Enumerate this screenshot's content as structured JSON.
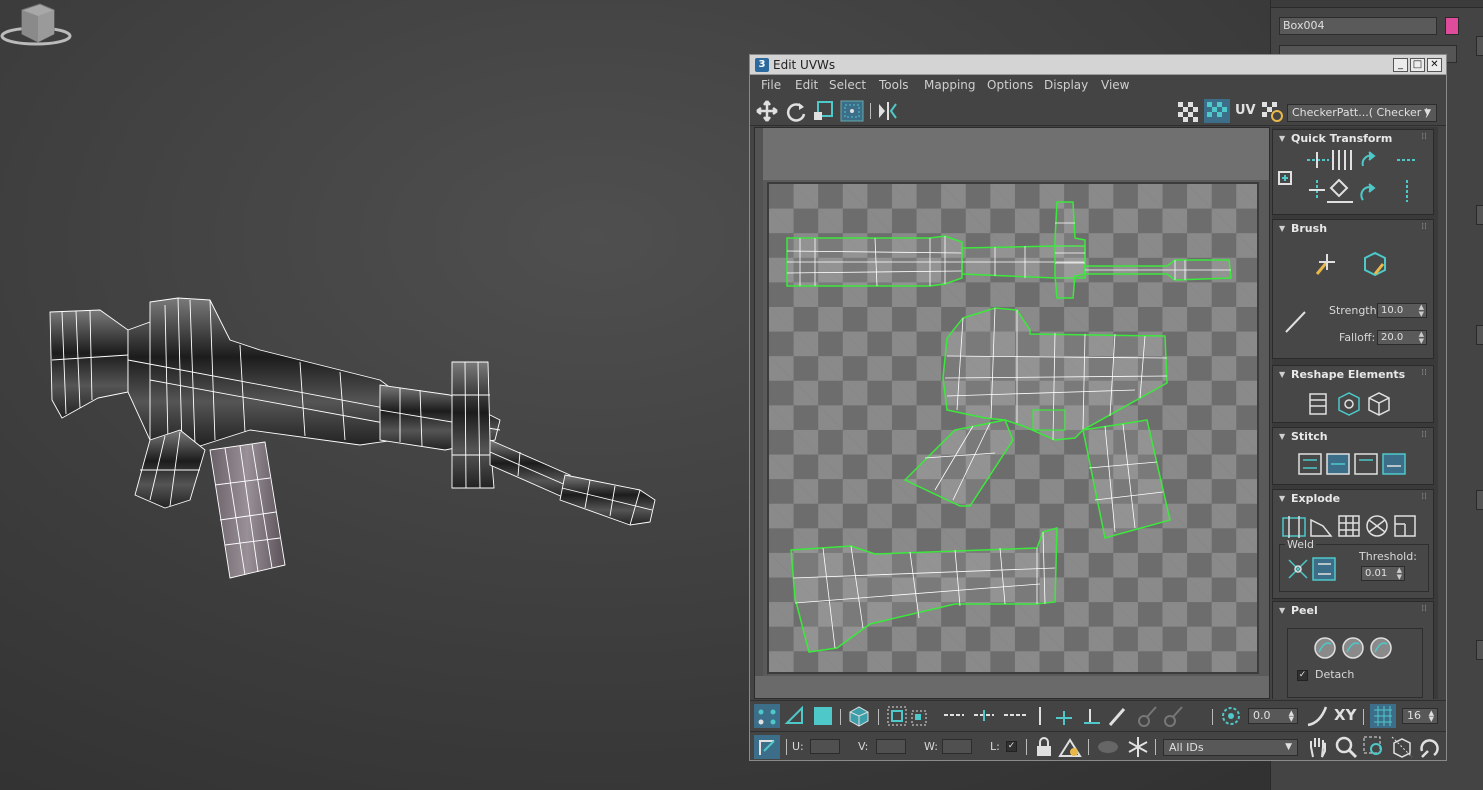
{
  "scene": {
    "object_name": "Box004",
    "object_color": "#e04c9c"
  },
  "window": {
    "title": "Edit UVWs",
    "minimize": "_",
    "maximize": "□",
    "close": "✕"
  },
  "menu": [
    "File",
    "Edit",
    "Select",
    "Tools",
    "Mapping",
    "Options",
    "Display",
    "View"
  ],
  "toolbar": {
    "uv_label": "UV",
    "checker_pattern": "CheckerPatt...( Checker )"
  },
  "rollouts": {
    "quick_transform": "Quick Transform",
    "brush": "Brush",
    "strength_label": "Strength:",
    "strength_value": "10.0",
    "falloff_label": "Falloff:",
    "falloff_value": "20.0",
    "reshape": "Reshape Elements",
    "stitch": "Stitch",
    "explode": "Explode",
    "weld_label": "Weld",
    "threshold_label": "Threshold:",
    "threshold_value": "0.01",
    "peel": "Peel",
    "detach_label": "Detach",
    "detach_checked": true
  },
  "bottom": {
    "soft_value": "0.0",
    "xy_label": "XY",
    "grid_value": "16",
    "u_label": "U:",
    "v_label": "V:",
    "w_label": "W:",
    "l_label": "L:",
    "material_ids": "All IDs"
  },
  "colors": {
    "uv_edge": "#ffffff",
    "uv_border": "#3de83d",
    "accent_teal": "#4ec8c8",
    "panel": "#444444"
  }
}
